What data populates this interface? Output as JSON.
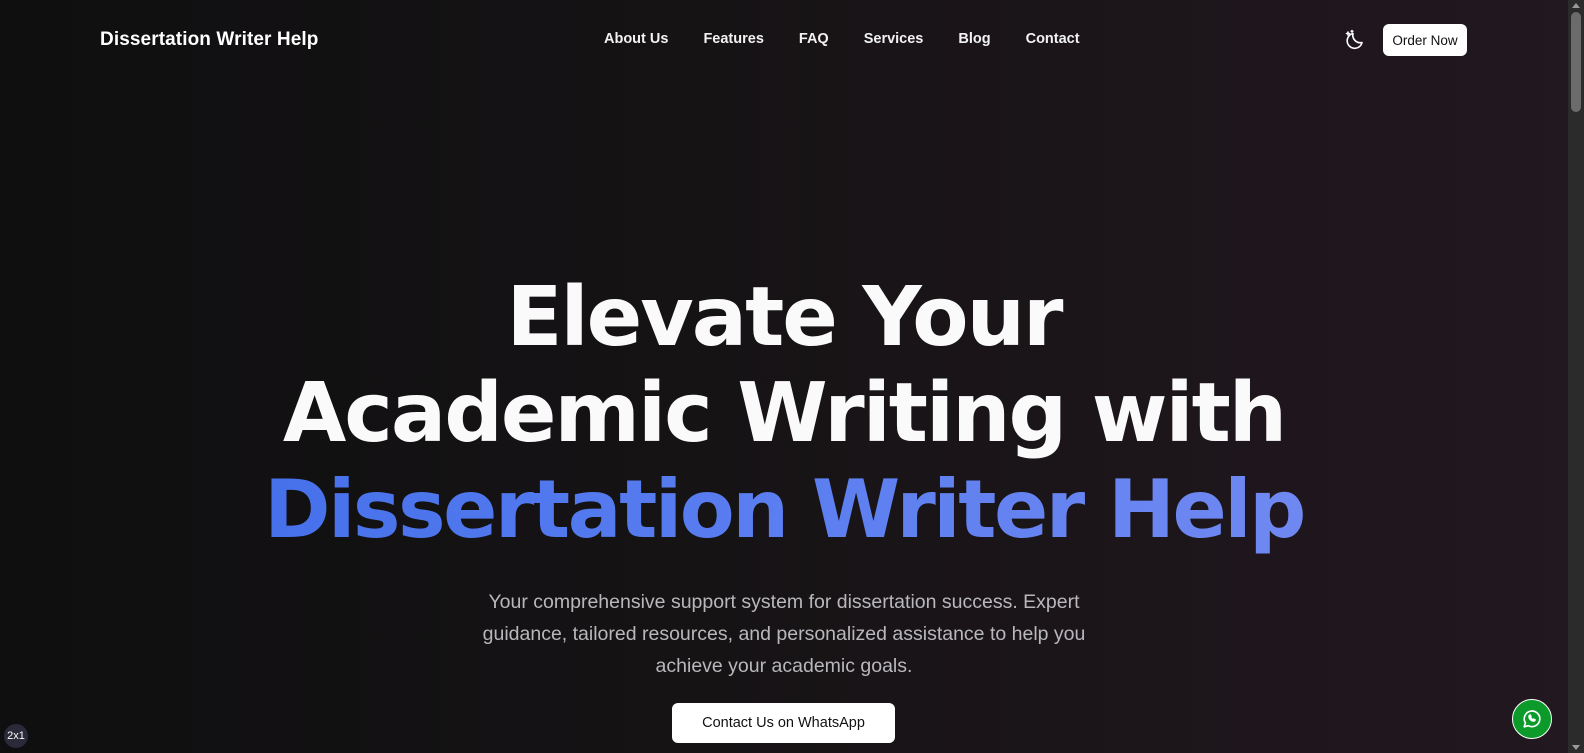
{
  "header": {
    "brand": "Dissertation Writer Help",
    "nav": [
      "About Us",
      "Features",
      "FAQ",
      "Services",
      "Blog",
      "Contact"
    ],
    "theme_toggle_icon": "moon-stars-icon",
    "order_label": "Order Now"
  },
  "hero": {
    "line1": "Elevate Your",
    "line2": "Academic Writing with",
    "line3": "Dissertation Writer Help",
    "subtitle": "Your comprehensive support system for dissertation success. Expert guidance, tailored resources, and personalized assistance to help you achieve your academic goals.",
    "cta_label": "Contact Us on WhatsApp",
    "accent_gradient": [
      "#3b6ae8",
      "#7a8ef2"
    ]
  },
  "floating": {
    "whatsapp_icon": "whatsapp-icon",
    "badge_text": "2x1"
  },
  "colors": {
    "background_left": "#0f0f10",
    "background_right": "#221820",
    "button_bg": "#ffffff",
    "whatsapp_green": "#0c9b2a"
  }
}
